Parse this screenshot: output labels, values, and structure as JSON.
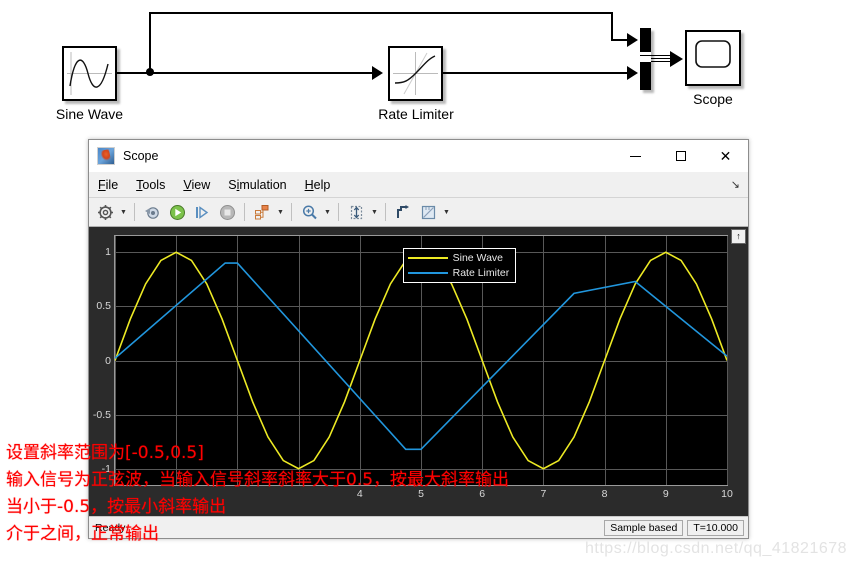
{
  "simulink": {
    "blocks": [
      {
        "name": "sine-wave",
        "label": "Sine Wave"
      },
      {
        "name": "rate-limiter",
        "label": "Rate Limiter"
      },
      {
        "name": "scope",
        "label": "Scope"
      }
    ],
    "mux_label": "",
    "sine_label": "Sine Wave",
    "rate_limiter_label": "Rate Limiter",
    "scope_label": "Scope"
  },
  "scope_window": {
    "title": "Scope",
    "icon": "matlab-icon",
    "window_buttons": {
      "minimize": "minimize-icon",
      "maximize": "maximize-icon",
      "close": "close-icon"
    },
    "menus": [
      {
        "pre": "",
        "mnemonic": "F",
        "post": "ile"
      },
      {
        "pre": "",
        "mnemonic": "T",
        "post": "ools"
      },
      {
        "pre": "",
        "mnemonic": "V",
        "post": "iew"
      },
      {
        "pre": "S",
        "mnemonic": "i",
        "post": "mulation"
      },
      {
        "pre": "",
        "mnemonic": "H",
        "post": "elp"
      }
    ],
    "menu_expand": "↘",
    "toolbar": [
      {
        "name": "configuration-properties-icon",
        "caret": true
      },
      {
        "sep": true
      },
      {
        "name": "update-diagram-icon",
        "caret": false
      },
      {
        "name": "run-icon",
        "caret": false
      },
      {
        "name": "step-forward-icon",
        "caret": false
      },
      {
        "name": "stop-icon",
        "caret": false
      },
      {
        "sep": true
      },
      {
        "name": "signal-selector-icon",
        "caret": true
      },
      {
        "sep": true
      },
      {
        "name": "zoom-in-icon",
        "caret": true
      },
      {
        "sep": true
      },
      {
        "name": "autoscale-icon",
        "caret": true
      },
      {
        "sep": true
      },
      {
        "name": "cursor-measurements-icon",
        "caret": false
      },
      {
        "name": "measurements-icon",
        "caret": true
      }
    ],
    "plot_corner_button": "↑",
    "status": {
      "ready": "Ready",
      "sample_mode": "Sample based",
      "time": "T=10.000"
    }
  },
  "chart_data": {
    "type": "line",
    "title": "",
    "xlabel": "",
    "ylabel": "",
    "xlim": [
      0,
      10
    ],
    "ylim": [
      -1.15,
      1.15
    ],
    "grid": true,
    "background": "#000000",
    "legend_position": "top-center",
    "xticks": [
      0,
      1,
      2,
      3,
      4,
      5,
      6,
      7,
      8,
      9,
      10
    ],
    "xtick_labels": [
      "",
      "",
      "",
      "",
      "4",
      "5",
      "6",
      "7",
      "8",
      "9",
      "10"
    ],
    "yticks": [
      1,
      0.5,
      0,
      -0.5,
      -1
    ],
    "ytick_labels": [
      "1",
      "0.5",
      "0",
      "-0.5",
      "-1"
    ],
    "series": [
      {
        "name": "Sine Wave",
        "color": "#edea24",
        "x": [
          0,
          0.25,
          0.5,
          0.75,
          1,
          1.25,
          1.5,
          1.75,
          2,
          2.25,
          2.5,
          2.75,
          3,
          3.25,
          3.5,
          3.75,
          4,
          4.25,
          4.5,
          4.75,
          5,
          5.25,
          5.5,
          5.75,
          6,
          6.25,
          6.5,
          6.75,
          7,
          7.25,
          7.5,
          7.75,
          8,
          8.25,
          8.5,
          8.75,
          9,
          9.25,
          9.5,
          9.75,
          10
        ],
        "y": [
          0,
          0.383,
          0.707,
          0.924,
          1,
          0.924,
          0.707,
          0.383,
          0,
          -0.383,
          -0.707,
          -0.924,
          -1,
          -0.924,
          -0.707,
          -0.383,
          0,
          0.383,
          0.707,
          0.924,
          1,
          0.924,
          0.707,
          0.383,
          0,
          -0.383,
          -0.707,
          -0.924,
          -1,
          -0.924,
          -0.707,
          -0.383,
          0,
          0.383,
          0.707,
          0.924,
          1,
          0.924,
          0.707,
          0.383,
          0
        ]
      },
      {
        "name": "Rate Limiter",
        "color": "#2196dd",
        "x": [
          0,
          1.8,
          2.0,
          4.75,
          5.0,
          7.5,
          8.5,
          10
        ],
        "y": [
          0.02,
          0.9,
          0.9,
          -0.82,
          -0.82,
          0.62,
          0.73,
          0.04
        ]
      }
    ]
  },
  "annotations": {
    "lines": [
      "设置斜率范围为[-0.5,0.5]",
      "输入信号为正弦波，当输入信号斜率斜率大于0.5，按最大斜率输出",
      "当小于-0.5，按最小斜率输出",
      "介于之间，正常输出"
    ],
    "color": "#ff0000"
  },
  "watermark": "https://blog.csdn.net/qq_41821678"
}
